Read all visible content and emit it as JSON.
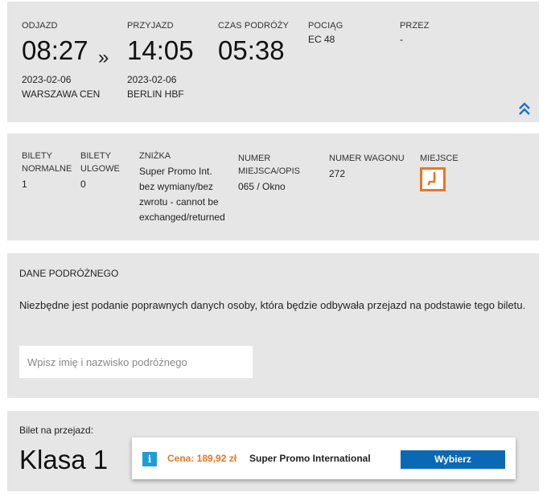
{
  "journey": {
    "departure": {
      "label": "ODJAZD",
      "time": "08:27",
      "date": "2023-02-06",
      "station": "WARSZAWA CEN"
    },
    "arrow": "»",
    "arrival": {
      "label": "PRZYJAZD",
      "time": "14:05",
      "date": "2023-02-06",
      "station": "BERLIN HBF"
    },
    "duration": {
      "label": "CZAS PODRÓŻY",
      "time": "05:38"
    },
    "train": {
      "label": "POCIĄG",
      "value": "EC 48"
    },
    "via": {
      "label": "PRZEZ",
      "value": "-"
    },
    "collapse_icon": "double-chevron-up-icon"
  },
  "ticket": {
    "normal": {
      "label_line1": "BILETY",
      "label_line2": "NORMALNE",
      "value": "1"
    },
    "reduced": {
      "label_line1": "BILETY",
      "label_line2": "ULGOWE",
      "value": "0"
    },
    "discount": {
      "label": "ZNIŻKA",
      "value_line1": "Super Promo Int.",
      "value_line2": "bez wymiany/bez",
      "value_line3": "zwrotu - cannot be",
      "value_line4": "exchanged/returned"
    },
    "seat_number": {
      "label_line1": "NUMER",
      "label_line2": "MIEJSCA/OPIS",
      "value": "065 / Okno"
    },
    "wagon": {
      "label": "NUMER WAGONU",
      "value": "272"
    },
    "seat": {
      "label": "MIEJSCE",
      "icon": "seat-icon"
    }
  },
  "passenger": {
    "title": "DANE PODRÓŻNEGO",
    "description": "Niezbędne jest podanie poprawnych danych osoby, która będzie odbywała przejazd na podstawie tego biletu.",
    "name_placeholder": "Wpisz imię i nazwisko podróżnego",
    "name_value": ""
  },
  "ticket_class": {
    "label": "Bilet na przejazd:",
    "value": "Klasa 1",
    "offer": {
      "info_icon": "i",
      "price": "Cena: 189,92 zł",
      "name": "Super Promo International",
      "button": "Wybierz"
    }
  },
  "colors": {
    "panel": "#e6e6e6",
    "accent_orange": "#e87722",
    "button_blue": "#0a69b5",
    "info_blue": "#1e9cd7",
    "link_blue": "#1a73c8"
  }
}
